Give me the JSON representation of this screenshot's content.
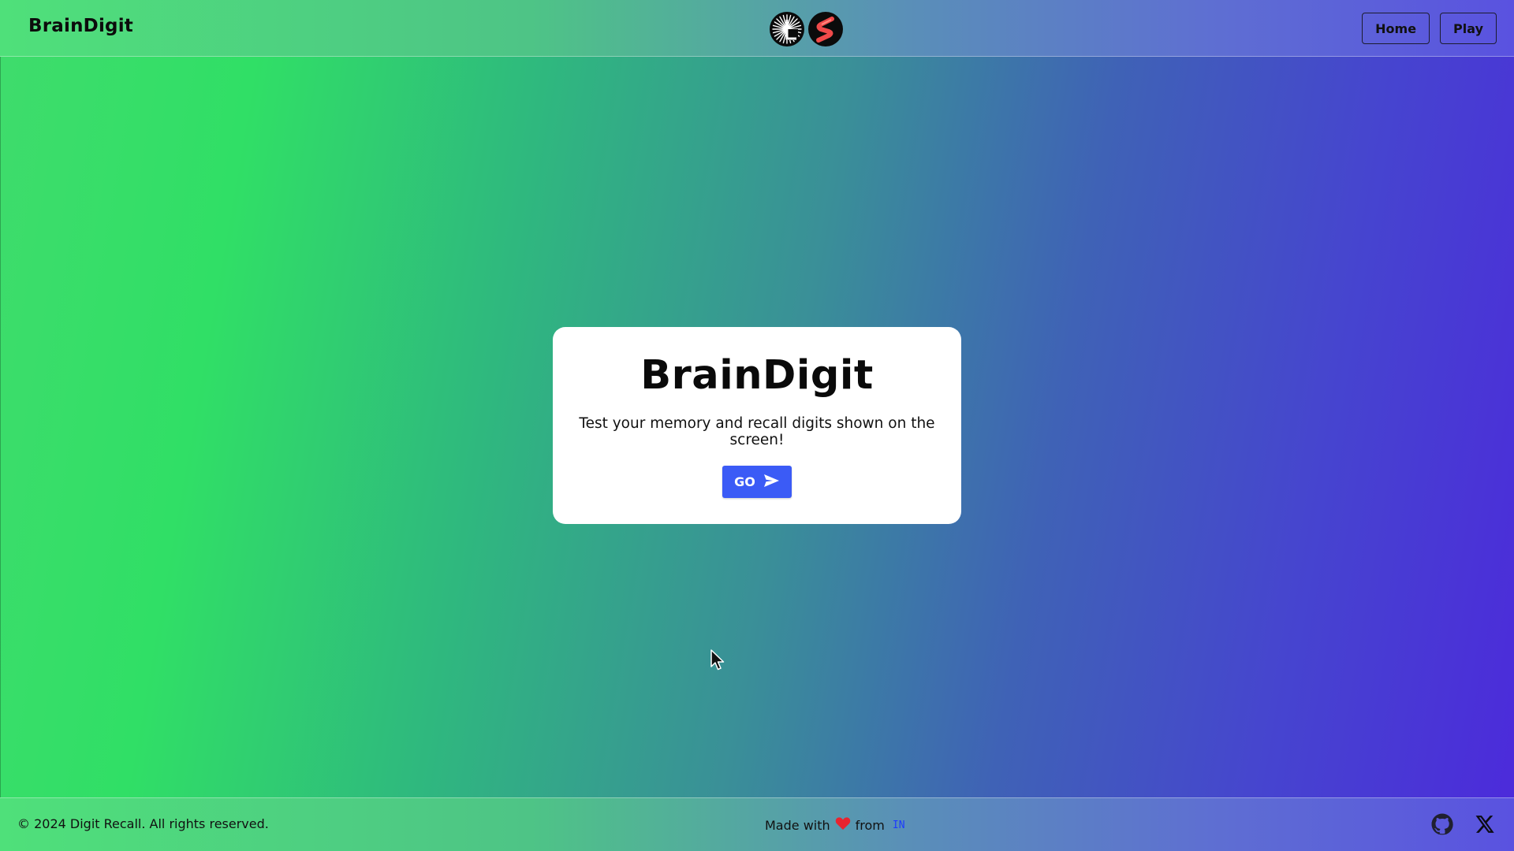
{
  "header": {
    "brand": "BrainDigit",
    "nav": {
      "home_label": "Home",
      "play_label": "Play"
    },
    "logos": [
      "radial-burst-logo",
      "s-logo"
    ]
  },
  "card": {
    "title": "BrainDigit",
    "subtitle": "Test your memory and recall digits shown on the screen!",
    "go_label": "GO",
    "go_icon": "send-icon",
    "go_color": "#3b5bf6"
  },
  "footer": {
    "copyright": "© 2024 Digit Recall. All rights reserved.",
    "made_with": "Made with",
    "from": "from",
    "country_code": "IN",
    "heart_color": "#e8242f",
    "social_icons": [
      "github-icon",
      "x-icon"
    ]
  },
  "theme": {
    "gradient_start": "#30df66",
    "gradient_end": "#4c2adb"
  }
}
